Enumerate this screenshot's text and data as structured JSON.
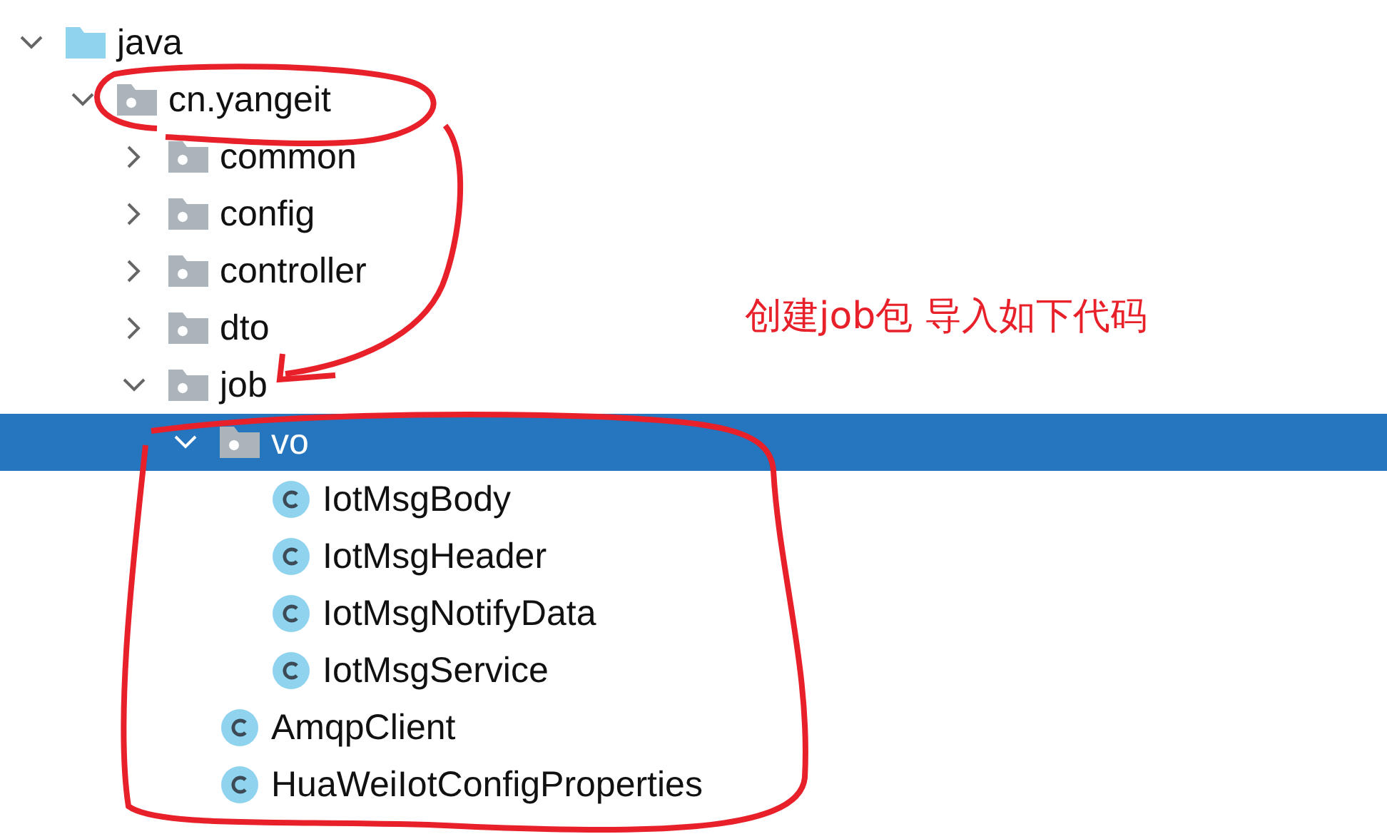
{
  "tree": [
    {
      "label": "java",
      "kind": "folder",
      "expanded": true,
      "selected": false,
      "children": [
        {
          "label": "cn.yangeit",
          "kind": "package",
          "expanded": true,
          "selected": false,
          "children": [
            {
              "label": "common",
              "kind": "package",
              "expanded": false,
              "selected": false
            },
            {
              "label": "config",
              "kind": "package",
              "expanded": false,
              "selected": false
            },
            {
              "label": "controller",
              "kind": "package",
              "expanded": false,
              "selected": false
            },
            {
              "label": "dto",
              "kind": "package",
              "expanded": false,
              "selected": false
            },
            {
              "label": "job",
              "kind": "package",
              "expanded": true,
              "selected": false,
              "children": [
                {
                  "label": "vo",
                  "kind": "package",
                  "expanded": true,
                  "selected": true,
                  "children": [
                    {
                      "label": "IotMsgBody",
                      "kind": "class",
                      "selected": false
                    },
                    {
                      "label": "IotMsgHeader",
                      "kind": "class",
                      "selected": false
                    },
                    {
                      "label": "IotMsgNotifyData",
                      "kind": "class",
                      "selected": false
                    },
                    {
                      "label": "IotMsgService",
                      "kind": "class",
                      "selected": false
                    }
                  ]
                },
                {
                  "label": "AmqpClient",
                  "kind": "class",
                  "selected": false
                },
                {
                  "label": "HuaWeiIotConfigProperties",
                  "kind": "class",
                  "selected": false
                }
              ]
            }
          ]
        }
      ]
    }
  ],
  "annotation": {
    "text": "创建job包 导入如下代码"
  }
}
